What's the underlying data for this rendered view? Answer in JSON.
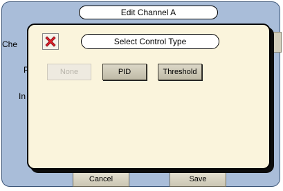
{
  "outer_window": {
    "title": "Edit Channel A",
    "labels": [
      "Che",
      "P",
      "In"
    ],
    "cancel_label": "Cancel",
    "save_label": "Save"
  },
  "dialog": {
    "title": "Select Control Type",
    "close_icon": "close-x-icon",
    "options": [
      {
        "label": "None",
        "enabled": false
      },
      {
        "label": "PID",
        "enabled": true
      },
      {
        "label": "Threshold",
        "enabled": true
      }
    ]
  },
  "colors": {
    "window_bg": "#a9bdd9",
    "dialog_bg": "#faf4dc",
    "close_red": "#e0202a"
  }
}
